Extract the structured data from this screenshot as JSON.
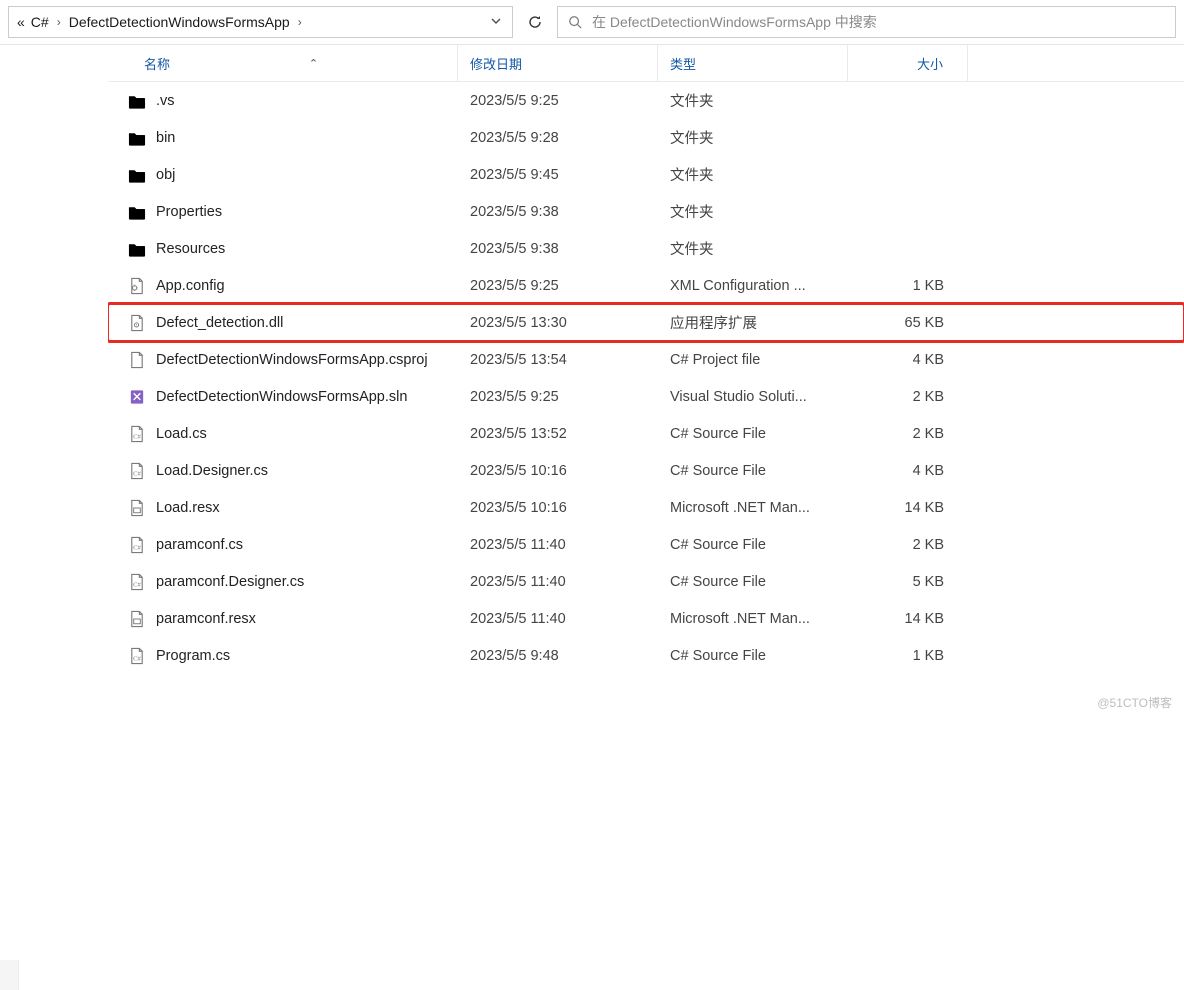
{
  "breadcrumb": {
    "more": "«",
    "parts": [
      "C#",
      "DefectDetectionWindowsFormsApp"
    ],
    "sep": "›"
  },
  "search": {
    "placeholder": "在 DefectDetectionWindowsFormsApp 中搜索"
  },
  "columns": {
    "name": "名称",
    "date": "修改日期",
    "type": "类型",
    "size": "大小"
  },
  "sort_indicator": "⌃",
  "rows": [
    {
      "icon": "folder-faded",
      "name": ".vs",
      "date": "2023/5/5 9:25",
      "type": "文件夹",
      "size": ""
    },
    {
      "icon": "folder",
      "name": "bin",
      "date": "2023/5/5 9:28",
      "type": "文件夹",
      "size": ""
    },
    {
      "icon": "folder",
      "name": "obj",
      "date": "2023/5/5 9:45",
      "type": "文件夹",
      "size": ""
    },
    {
      "icon": "folder",
      "name": "Properties",
      "date": "2023/5/5 9:38",
      "type": "文件夹",
      "size": ""
    },
    {
      "icon": "folder",
      "name": "Resources",
      "date": "2023/5/5 9:38",
      "type": "文件夹",
      "size": ""
    },
    {
      "icon": "config",
      "name": "App.config",
      "date": "2023/5/5 9:25",
      "type": "XML Configuration ...",
      "size": "1 KB"
    },
    {
      "icon": "dll",
      "name": "Defect_detection.dll",
      "date": "2023/5/5 13:30",
      "type": "应用程序扩展",
      "size": "65 KB",
      "highlight": true
    },
    {
      "icon": "file",
      "name": "DefectDetectionWindowsFormsApp.csproj",
      "date": "2023/5/5 13:54",
      "type": "C# Project file",
      "size": "4 KB"
    },
    {
      "icon": "sln",
      "name": "DefectDetectionWindowsFormsApp.sln",
      "date": "2023/5/5 9:25",
      "type": "Visual Studio Soluti...",
      "size": "2 KB"
    },
    {
      "icon": "cs",
      "name": "Load.cs",
      "date": "2023/5/5 13:52",
      "type": "C# Source File",
      "size": "2 KB"
    },
    {
      "icon": "cs",
      "name": "Load.Designer.cs",
      "date": "2023/5/5 10:16",
      "type": "C# Source File",
      "size": "4 KB"
    },
    {
      "icon": "resx",
      "name": "Load.resx",
      "date": "2023/5/5 10:16",
      "type": "Microsoft .NET Man...",
      "size": "14 KB"
    },
    {
      "icon": "cs",
      "name": "paramconf.cs",
      "date": "2023/5/5 11:40",
      "type": "C# Source File",
      "size": "2 KB"
    },
    {
      "icon": "cs",
      "name": "paramconf.Designer.cs",
      "date": "2023/5/5 11:40",
      "type": "C# Source File",
      "size": "5 KB"
    },
    {
      "icon": "resx",
      "name": "paramconf.resx",
      "date": "2023/5/5 11:40",
      "type": "Microsoft .NET Man...",
      "size": "14 KB"
    },
    {
      "icon": "cs",
      "name": "Program.cs",
      "date": "2023/5/5 9:48",
      "type": "C# Source File",
      "size": "1 KB"
    }
  ],
  "watermark": "@51CTO博客"
}
